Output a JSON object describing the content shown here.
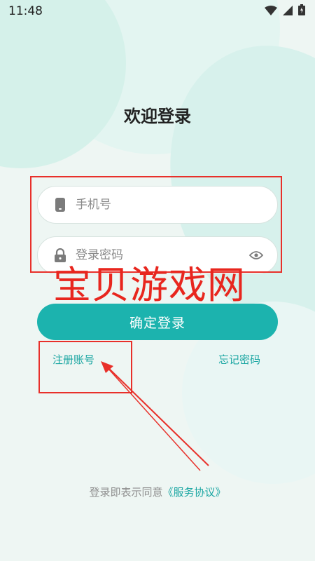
{
  "status_bar": {
    "time": "11:48",
    "icons": [
      "wifi-icon",
      "signal-icon",
      "battery-icon"
    ]
  },
  "page": {
    "title": "欢迎登录"
  },
  "form": {
    "phone_placeholder": "手机号",
    "password_placeholder": "登录密码",
    "phone_icon": "phone-icon",
    "lock_icon": "lock-icon",
    "eye_icon": "eye-icon"
  },
  "actions": {
    "login_label": "确定登录",
    "register_label": "注册账号",
    "forgot_label": "忘记密码"
  },
  "agreement": {
    "prefix": "登录即表示同意",
    "terms_label": "《服务协议》"
  },
  "overlay": {
    "watermark_text": "宝贝游戏网"
  },
  "colors": {
    "accent": "#1cb3ae",
    "link": "#1aa6a2",
    "annotation_red": "#e8302a",
    "background": "#eef6f3"
  }
}
